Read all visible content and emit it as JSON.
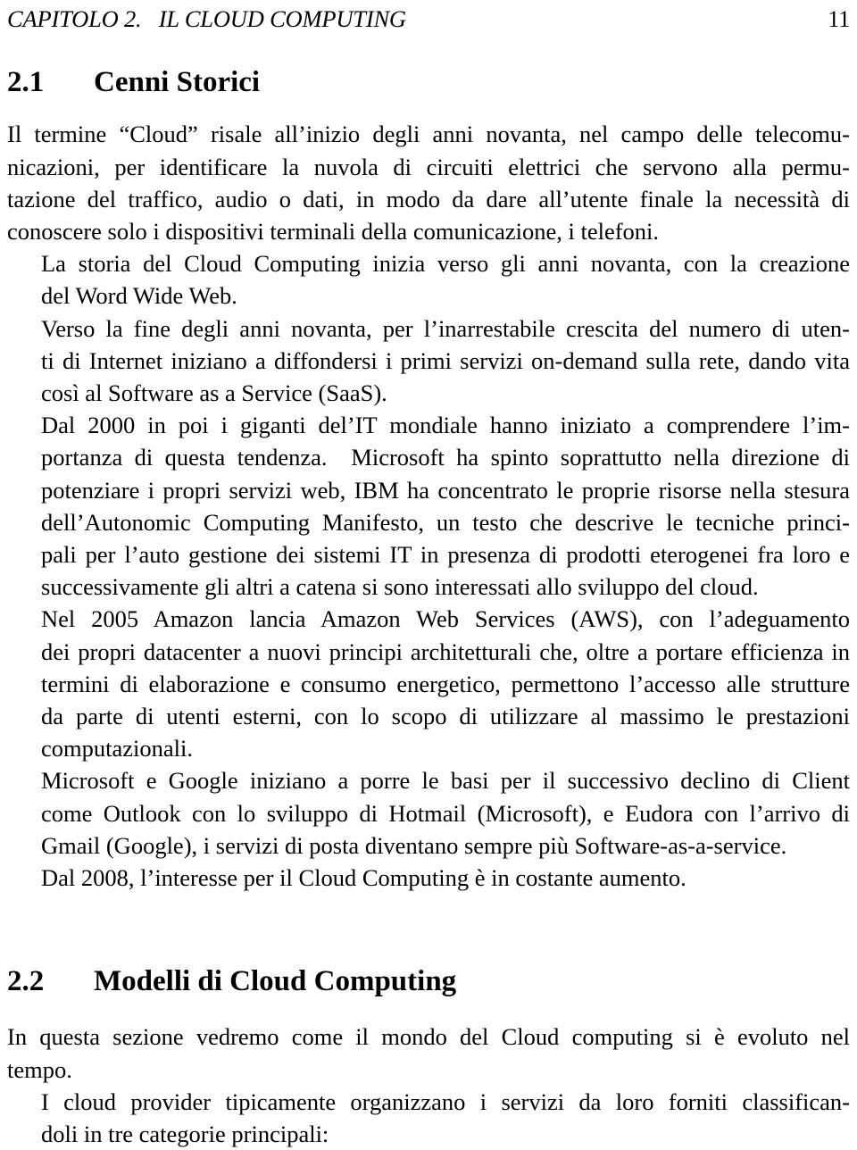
{
  "document": {
    "language": "it",
    "page_number": "11",
    "running_header": "CAPITOLO 2.   IL CLOUD COMPUTING"
  },
  "sections": [
    {
      "number": "2.1",
      "title": "Cenni Storici",
      "paragraphs": [
        {
          "indent": false,
          "lines": [
            "Il termine “Cloud” risale all’inizio degli anni novanta, nel campo delle telecomu-",
            "nicazioni, per identificare la nuvola di circuiti elettrici che servono alla permu-",
            "tazione del traffico, audio o dati, in modo da dare all’utente finale la necessità di",
            "conoscere solo i dispositivi terminali della comunicazione, i telefoni."
          ]
        },
        {
          "indent": true,
          "lines": [
            "La storia del Cloud Computing inizia verso gli anni novanta, con la creazione",
            "del Word Wide Web."
          ]
        },
        {
          "indent": true,
          "lines": [
            "Verso la fine degli anni novanta, per l’inarrestabile crescita del numero di uten-",
            "ti di Internet iniziano a diffondersi i primi servizi on-demand sulla rete, dando vita",
            "così al Software as a Service (SaaS)."
          ]
        },
        {
          "indent": true,
          "lines": [
            "Dal 2000 in poi i giganti del’IT mondiale hanno iniziato a comprendere l’im-",
            "portanza di questa tendenza.  Microsoft ha spinto soprattutto nella direzione di",
            "potenziare i propri servizi web, IBM ha concentrato le proprie risorse nella stesura",
            "dell’Autonomic Computing Manifesto, un testo che descrive le tecniche princi-",
            "pali per l’auto gestione dei sistemi IT in presenza di prodotti eterogenei fra loro e",
            "successivamente gli altri a catena si sono interessati allo sviluppo del cloud."
          ]
        },
        {
          "indent": true,
          "lines": [
            "Nel 2005 Amazon lancia Amazon Web Services (AWS), con l’adeguamento",
            "dei propri datacenter a nuovi principi architetturali che, oltre a portare efficienza in",
            "termini di elaborazione e consumo energetico, permettono l’accesso alle strutture",
            "da parte di utenti esterni, con lo scopo di utilizzare al massimo le prestazioni",
            "computazionali."
          ]
        },
        {
          "indent": true,
          "lines": [
            "Microsoft e Google iniziano a porre le basi per il successivo declino di Client",
            "come Outlook con lo sviluppo di Hotmail (Microsoft), e Eudora con l’arrivo di",
            "Gmail (Google), i servizi di posta diventano sempre più Software-as-a-service."
          ]
        },
        {
          "indent": true,
          "lines": [
            "Dal 2008, l’interesse per il Cloud Computing è in costante aumento."
          ]
        }
      ]
    },
    {
      "number": "2.2",
      "title": "Modelli di Cloud Computing",
      "paragraphs": [
        {
          "indent": false,
          "lines": [
            "In questa sezione vedremo come il mondo del Cloud computing si è evoluto nel",
            "tempo."
          ]
        },
        {
          "indent": true,
          "lines": [
            "I cloud provider tipicamente organizzano i servizi da loro forniti classifican-",
            "doli in tre categorie principali:"
          ]
        }
      ]
    }
  ]
}
